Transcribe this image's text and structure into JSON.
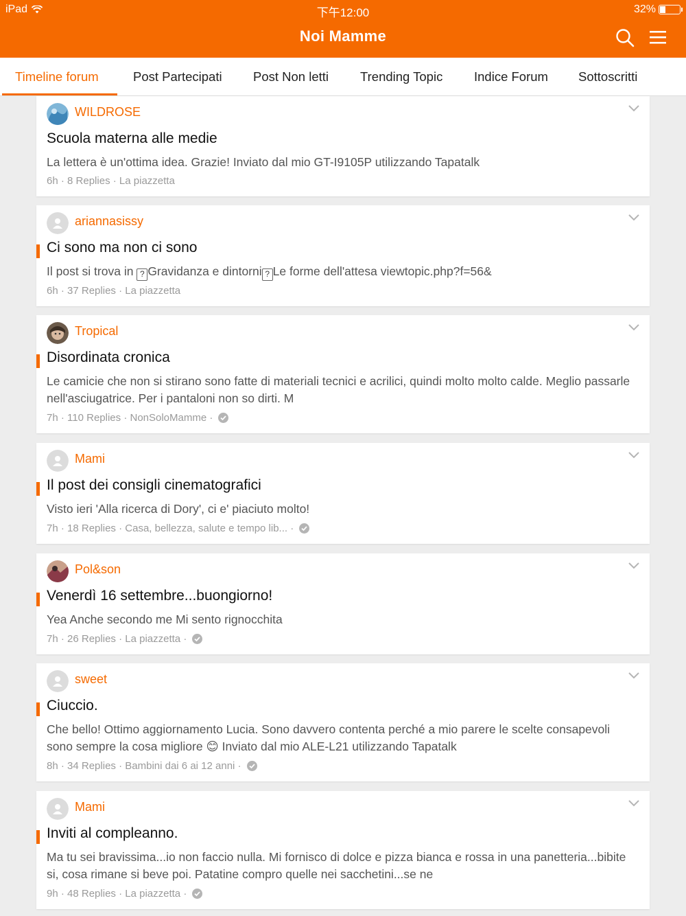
{
  "status": {
    "device": "iPad",
    "time": "下午12:00",
    "battery": "32%"
  },
  "header": {
    "title": "Noi Mamme"
  },
  "tabs": [
    {
      "label": "Timeline forum"
    },
    {
      "label": "Post Partecipati"
    },
    {
      "label": "Post Non letti"
    },
    {
      "label": "Trending Topic"
    },
    {
      "label": "Indice Forum"
    },
    {
      "label": "Sottoscritti"
    }
  ],
  "posts": [
    {
      "author": "WILDROSE",
      "title": "Scuola materna alle medie",
      "preview": "La lettera è un'ottima idea. Grazie!  Inviato dal mio GT-I9105P utilizzando Tapatalk",
      "time": "6h",
      "replies": "8 Replies",
      "forum": "La piazzetta"
    },
    {
      "author": "ariannasissy",
      "title": "Ci sono ma non ci sono",
      "preview_parts": [
        "Il post si trova in ",
        "?",
        "Gravidanza e dintorni",
        "?",
        "Le forme dell'attesa viewtopic.php?f=56&"
      ],
      "time": "6h",
      "replies": "37 Replies",
      "forum": "La piazzetta"
    },
    {
      "author": "Tropical",
      "title": "Disordinata cronica",
      "preview": "Le camicie che non si stirano sono fatte di materiali tecnici e acrilici, quindi molto molto calde. Meglio passarle nell'asciugatrice.   Per i pantaloni non so dirti. M",
      "time": "7h",
      "replies": "110 Replies",
      "forum": "NonSoloMamme"
    },
    {
      "author": "Mami",
      "title": "Il post dei consigli cinematografici",
      "preview": "Visto ieri 'Alla ricerca di Dory', ci e' piaciuto molto!",
      "time": "7h",
      "replies": "18 Replies",
      "forum": "Casa, bellezza, salute e tempo lib..."
    },
    {
      "author": "Pol&son",
      "title": "Venerdì 16 settembre...buongiorno!",
      "preview": "Yea Anche secondo me Mi sento rignocchita",
      "time": "7h",
      "replies": "26 Replies",
      "forum": "La piazzetta"
    },
    {
      "author": "sweet",
      "title": "Ciuccio.",
      "preview_a": "Che bello! Ottimo aggiornamento Lucia. Sono davvero contenta perché a mio parere le scelte consapevoli sono sempre la cosa migliore ",
      "preview_emoji": "😊",
      "preview_b": "  Inviato dal mio ALE-L21 utilizzando Tapatalk",
      "time": "8h",
      "replies": "34 Replies",
      "forum": "Bambini dai 6 ai 12 anni"
    },
    {
      "author": "Mami",
      "title": "Inviti al compleanno.",
      "preview": "Ma tu sei bravissima...io non faccio nulla. Mi fornisco di dolce e pizza bianca e rossa in una panetteria...bibite si, cosa rimane si beve poi. Patatine compro quelle nei sacchetini...se ne",
      "time": "9h",
      "replies": "48 Replies",
      "forum": "La piazzetta"
    }
  ],
  "meta_separator": "·",
  "colors": {
    "accent": "#f56a00",
    "background": "#ededed"
  },
  "icons": {
    "search": "search-icon",
    "menu": "hamburger-menu-icon",
    "more": "chevron-down-icon",
    "verified": "checkmark-icon"
  }
}
